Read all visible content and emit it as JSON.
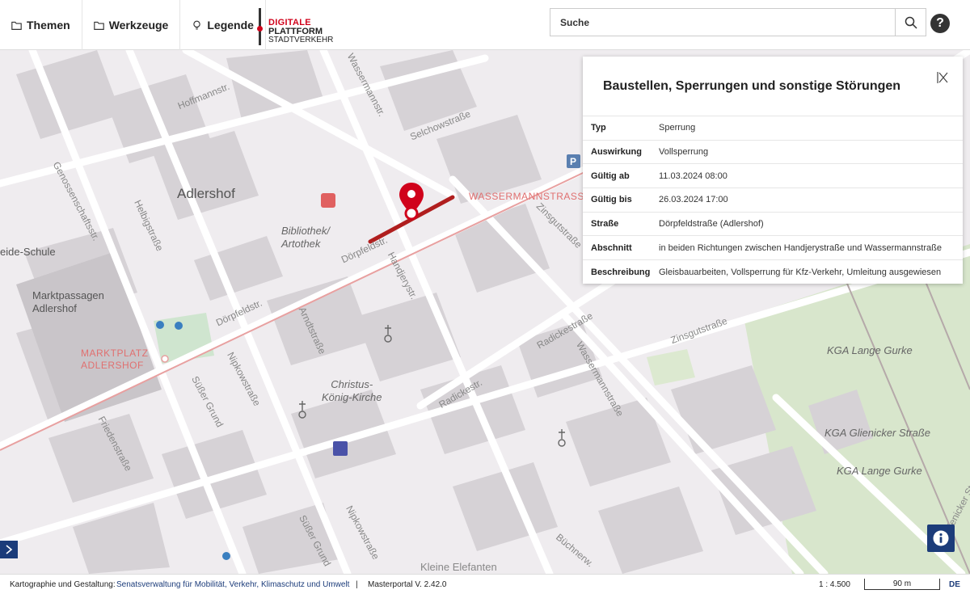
{
  "menu": {
    "themes": "Themen",
    "tools": "Werkzeuge",
    "legend": "Legende"
  },
  "logo": {
    "line1": "DIGITALE",
    "line2": "PLATTFORM",
    "line3": "STADTVERKEHR"
  },
  "search": {
    "placeholder": "Suche"
  },
  "help_label": "?",
  "map_labels": {
    "district": "Adlershof",
    "library": "Bibliothek/\nArtothek",
    "market_passages": "Marktpassagen\nAdlershof",
    "school": "eide-Schule",
    "market_square": "MARKTPLATZ\nADLERSHOF",
    "wassermann_caps": "WASSERMANNSTRASSE",
    "church": "Christus-\nKönig-Kirche",
    "kga1": "KGA Lange Gurke",
    "kga2": "KGA Glienicker Straße",
    "kga3": "KGA Lange Gurke",
    "kleine_elefanten": "Kleine Elefanten",
    "streets": {
      "hoffmannstr": "Hoffmannstr.",
      "selchowstr": "Selchowstraße",
      "wassermannstr": "Wassermannstr.",
      "zinsgutstr": "Zinsgutstraße",
      "zinsgutstr2": "Zinsgutstraße",
      "helbigstr": "Helbigstraße",
      "dorpfeldstr": "Dörpfeldstr.",
      "dorpfeldstr2": "Dörpfeldstr.",
      "arndtstr": "Arndtstraße",
      "nipkowstr": "Nipkowstraße",
      "nipkowstr2": "Nipkowstraße",
      "radickestr": "Radickestraße",
      "radickestr2": "Radickestr.",
      "wassermannstr2": "Wassermannstraße",
      "friedenstr": "Friedenstraße",
      "susser_grund": "Süßer Grund",
      "susser_grund2": "Süßer Grund",
      "handjerystr": "Handjerystr.",
      "genossenschaftsstr": "Genossenschaftsstr.",
      "buchnerweg": "Büchnerw.",
      "glienicker": "Glienicker Str."
    }
  },
  "panel": {
    "title": "Baustellen, Sperrungen und sonstige Störungen",
    "rows": [
      {
        "key": "Typ",
        "value": "Sperrung"
      },
      {
        "key": "Auswirkung",
        "value": "Vollsperrung"
      },
      {
        "key": "Gültig ab",
        "value": "11.03.2024 08:00"
      },
      {
        "key": "Gültig bis",
        "value": "26.03.2024 17:00"
      },
      {
        "key": "Straße",
        "value": "Dörpfeldstraße (Adlershof)"
      },
      {
        "key": "Abschnitt",
        "value": "in beiden Richtungen zwischen Handjerystraße und Wassermannstraße"
      },
      {
        "key": "Beschreibung",
        "value": "Gleisbauarbeiten, Vollsperrung für Kfz-Verkehr, Umleitung ausgewiesen"
      }
    ]
  },
  "footer": {
    "credit_label": "Kartographie und Gestaltung:",
    "credit_link": "Senatsverwaltung für Mobilität, Verkehr, Klimaschutz und Umwelt",
    "separator": "|",
    "version": "Masterportal V. 2.42.0",
    "scale": "1 : 4.500",
    "scalebar": "90 m",
    "language": "DE"
  },
  "colors": {
    "accent": "#1c3c7a",
    "closure": "#b01e1e",
    "marker": "#d0021b",
    "tram": "#e8a0a0"
  },
  "icons": {
    "themes": "folder-icon",
    "tools": "folder-icon",
    "legend": "lightbulb-icon",
    "search": "search-icon",
    "help": "help-icon",
    "close": "close-icon",
    "info": "info-icon",
    "expand": "chevron-right-icon"
  }
}
